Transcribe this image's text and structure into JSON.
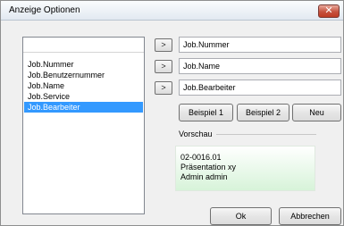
{
  "window": {
    "title": "Anzeige Optionen",
    "close_label": "✕"
  },
  "fields_list": {
    "items": [
      {
        "label": "Job.Nummer",
        "selected": false
      },
      {
        "label": "Job.Benutzernummer",
        "selected": false
      },
      {
        "label": "Job.Name",
        "selected": false
      },
      {
        "label": "Job.Service",
        "selected": false
      },
      {
        "label": "Job.Bearbeiter",
        "selected": true
      }
    ]
  },
  "display_fields": [
    {
      "button_label": ">",
      "value": "Job.Nummer"
    },
    {
      "button_label": ">",
      "value": "Job.Name"
    },
    {
      "button_label": ">",
      "value": "Job.Bearbeiter"
    }
  ],
  "example_buttons": {
    "beispiel1": "Beispiel 1",
    "beispiel2": "Beispiel 2",
    "neu": "Neu"
  },
  "preview": {
    "label": "Vorschau",
    "lines": [
      "02-0016.01",
      "Präsentation xy",
      "Admin admin"
    ]
  },
  "footer": {
    "ok": "Ok",
    "cancel": "Abbrechen"
  },
  "colors": {
    "selection": "#3399ff",
    "preview_gradient_end": "#d7f3d9",
    "close_button": "#c6523e"
  }
}
